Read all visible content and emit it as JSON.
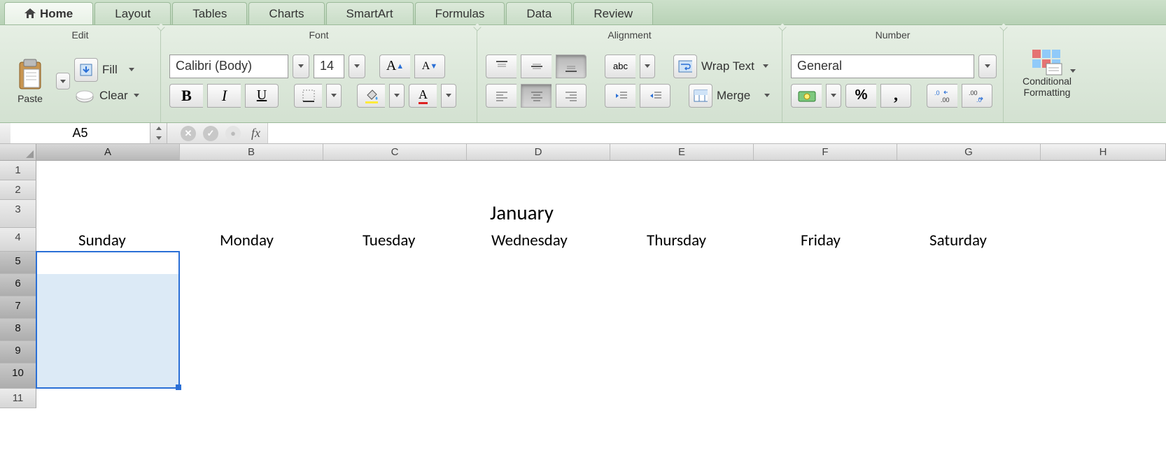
{
  "tabs": [
    "Home",
    "Layout",
    "Tables",
    "Charts",
    "SmartArt",
    "Formulas",
    "Data",
    "Review"
  ],
  "active_tab": "Home",
  "groups": {
    "edit": "Edit",
    "font": "Font",
    "alignment": "Alignment",
    "number": "Number"
  },
  "edit": {
    "paste": "Paste",
    "fill": "Fill",
    "clear": "Clear"
  },
  "font": {
    "name": "Calibri (Body)",
    "size": "14",
    "bold": "B",
    "italic": "I",
    "underline": "U"
  },
  "alignment": {
    "abc": "abc",
    "wrap": "Wrap Text",
    "merge": "Merge"
  },
  "number": {
    "format": "General",
    "percent": "%",
    "comma": ","
  },
  "cond": {
    "l1": "Conditional",
    "l2": "Formatting"
  },
  "namebox": "A5",
  "fx": "fx",
  "columns": [
    "A",
    "B",
    "C",
    "D",
    "E",
    "F",
    "G",
    "H"
  ],
  "rowcount": 11,
  "month": "January",
  "days": [
    "Sunday",
    "Monday",
    "Tuesday",
    "Wednesday",
    "Thursday",
    "Friday",
    "Saturday"
  ]
}
